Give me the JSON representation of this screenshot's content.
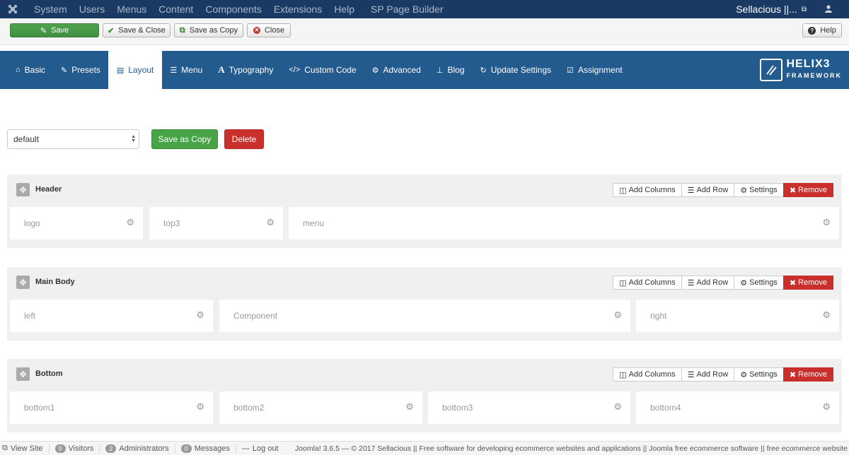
{
  "topnav": {
    "menu": [
      "System",
      "Users",
      "Menus",
      "Content",
      "Components",
      "Extensions",
      "Help",
      "SP Page Builder"
    ],
    "site_name": "Sellacious ||..."
  },
  "toolbar": {
    "save": "Save",
    "save_close": "Save & Close",
    "save_copy": "Save as Copy",
    "close": "Close",
    "help": "Help"
  },
  "helix_tabs": [
    {
      "label": "Basic",
      "icon": "home-icon"
    },
    {
      "label": "Presets",
      "icon": "brush-icon"
    },
    {
      "label": "Layout",
      "icon": "layout-icon"
    },
    {
      "label": "Menu",
      "icon": "list-icon"
    },
    {
      "label": "Typography",
      "icon": "font-icon"
    },
    {
      "label": "Custom Code",
      "icon": "code-icon"
    },
    {
      "label": "Advanced",
      "icon": "gear-icon"
    },
    {
      "label": "Blog",
      "icon": "pin-icon"
    },
    {
      "label": "Update Settings",
      "icon": "refresh-icon"
    },
    {
      "label": "Assignment",
      "icon": "check-icon"
    }
  ],
  "helix_logo": {
    "word": "HELIX3",
    "sub": "FRAMEWORK"
  },
  "layout": {
    "selected": "default",
    "save_copy": "Save as Copy",
    "delete": "Delete"
  },
  "section_tools": {
    "add_columns": "Add Columns",
    "add_row": "Add Row",
    "settings": "Settings",
    "remove": "Remove"
  },
  "sections": [
    {
      "title": "Header",
      "columns": [
        "logo",
        "top3",
        "menu"
      ]
    },
    {
      "title": "Main Body",
      "columns": [
        "left",
        "Component",
        "right"
      ]
    },
    {
      "title": "Bottom",
      "columns": [
        "bottom1",
        "bottom2",
        "bottom3",
        "bottom4"
      ]
    }
  ],
  "statusbar": {
    "view_site": "View Site",
    "visitors_count": "0",
    "visitors": "Visitors",
    "admins_count": "2",
    "admins": "Administrators",
    "messages_count": "0",
    "messages": "Messages",
    "logout": "Log out",
    "footer": "Joomla! 3.6.5 — © 2017 Sellacious || Free software for developing ecommerce websites and applications || Joomla free ecommerce software || free ecommerce website"
  }
}
